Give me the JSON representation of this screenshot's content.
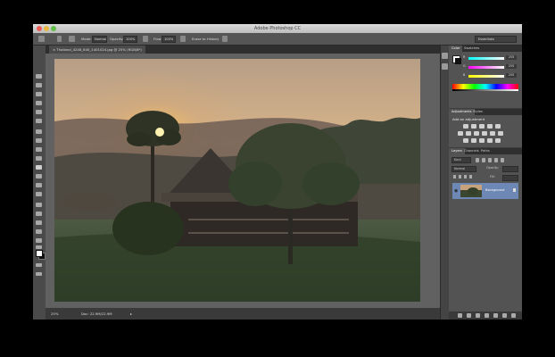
{
  "app": {
    "title": "Adobe Photoshop CC",
    "workspace": "Essentials"
  },
  "options": {
    "mode_label": "Mode:",
    "mode_value": "Normal",
    "opacity_label": "Opacity:",
    "opacity_value": "100%",
    "flow_label": "Flow:",
    "flow_value": "100%",
    "erase_history": "Erase to History"
  },
  "document": {
    "tab_label": "× Thailand_4248_640_1401024.jpg @ 25% (RGB/8*)",
    "zoom": "25%",
    "doc_info": "Doc: 22.9M/22.9M"
  },
  "colors": {
    "foreground": "#ffffff",
    "background": "#111111",
    "accent": "#6d88b4"
  },
  "panels": {
    "color_tabs": [
      "Color",
      "Swatches"
    ],
    "color_values": {
      "r": "255",
      "g": "255",
      "b": "255"
    },
    "channel_labels": [
      "R",
      "G",
      "B"
    ],
    "adjustments_tabs": [
      "Adjustments",
      "Styles"
    ],
    "adjustments_title": "Add an adjustment",
    "layers_tabs": [
      "Layers",
      "Channels",
      "Paths"
    ],
    "layers_kind": "Kind",
    "layers_blend": "Normal",
    "layers_opacity": "Opacity:",
    "layers_fill": "Fill:",
    "layer_name": "Background"
  },
  "icons": {
    "tools": [
      "move-tool-icon",
      "marquee-tool-icon",
      "lasso-tool-icon",
      "quick-select-tool-icon",
      "crop-tool-icon",
      "eyedropper-tool-icon",
      "healing-brush-icon",
      "brush-tool-icon",
      "clone-stamp-icon",
      "history-brush-icon",
      "eraser-tool-icon",
      "gradient-tool-icon",
      "blur-tool-icon",
      "dodge-tool-icon",
      "pen-tool-icon",
      "type-tool-icon",
      "path-select-icon",
      "shape-tool-icon",
      "hand-tool-icon",
      "zoom-tool-icon"
    ]
  }
}
